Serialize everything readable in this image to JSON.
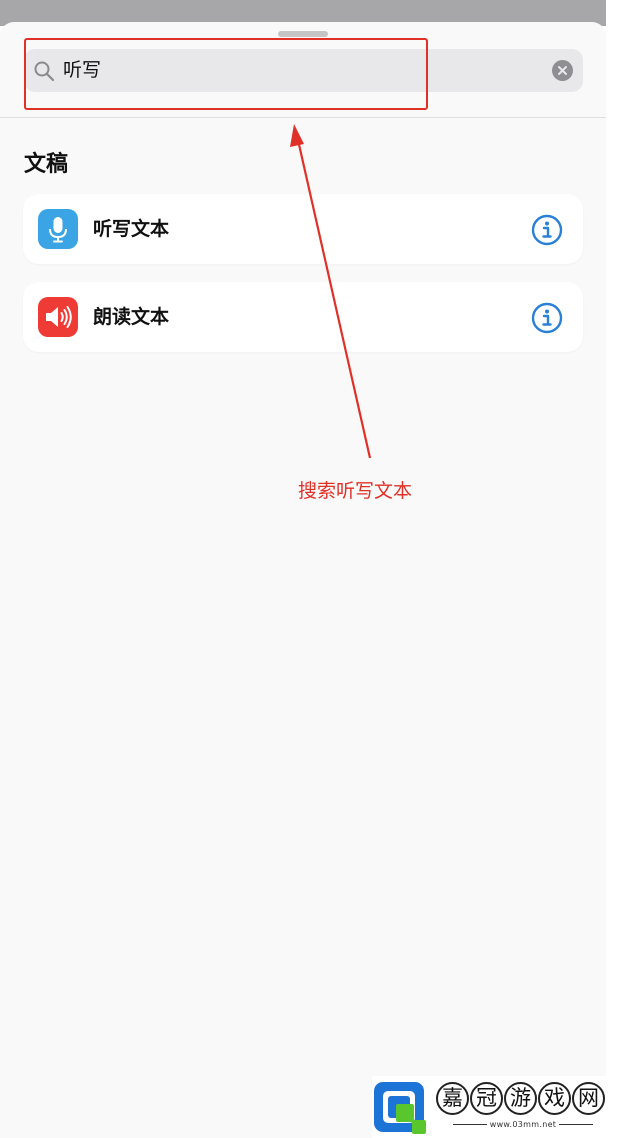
{
  "search": {
    "value": "听写"
  },
  "section": {
    "title": "文稿"
  },
  "actions": [
    {
      "label": "听写文本",
      "icon": "microphone-icon",
      "icon_color": "#3aa4e4"
    },
    {
      "label": "朗读文本",
      "icon": "speaker-icon",
      "icon_color": "#ef3b36"
    }
  ],
  "annotation": {
    "text": "搜索听写文本",
    "color": "#e03128"
  },
  "watermark": {
    "chars": [
      "嘉",
      "冠",
      "游",
      "戏",
      "网"
    ],
    "url": "www.03mm.net"
  },
  "colors": {
    "accent": "#2a7fd6",
    "sheet_background": "#f9f9f9"
  }
}
